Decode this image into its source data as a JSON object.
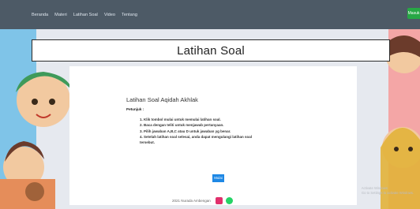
{
  "nav": {
    "items": [
      "Beranda",
      "Materi",
      "Latihan Soal",
      "Video",
      "Tentang"
    ],
    "button_label": "Masuk"
  },
  "banner": {
    "title": "Latihan Soal"
  },
  "card": {
    "title": "Latihan Soal Aqidah Akhlak",
    "subtitle": "Petunjuk :",
    "steps": [
      "1. Klik tombol mulai untuk memulai latihan soal.",
      "2. Baca dengan teliti untuk menjawab pertanyaan.",
      "3. Pilih jawaban A,B,C atau D untuk jawaban yg benar.",
      "4. Setelah latihan soal selesai, anda dapat mengulangi latihan soal",
      "tersebut."
    ],
    "start_label": "Mulai"
  },
  "footer": {
    "copyright": "2021 Nurada Ambengan"
  },
  "watermark": {
    "line1": "Activate Windows",
    "line2": "Go to Settings to activate Windows."
  },
  "colors": {
    "nav": "#4d5a66",
    "accent": "#1e88e5",
    "success": "#27a745"
  }
}
